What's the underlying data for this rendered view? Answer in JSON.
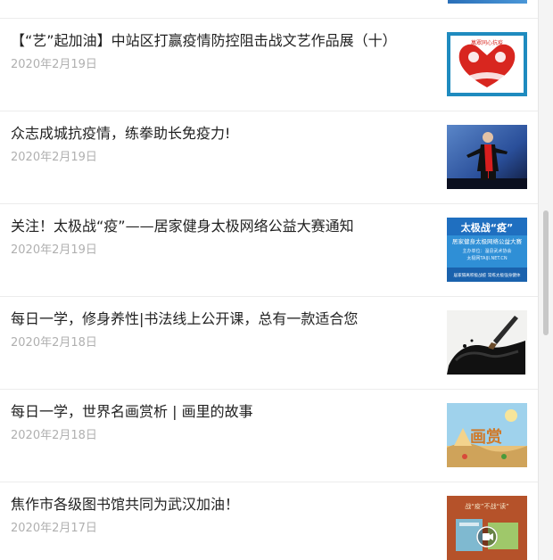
{
  "articles": [
    {
      "title": "【“艺”起加油】中站区打赢疫情防控阻击战文艺作品展（十）",
      "date": "2020年2月19日",
      "thumb_text": "萬眾同心抗疫"
    },
    {
      "title": "众志成城抗疫情，练拳助长免疫力!",
      "date": "2020年2月19日"
    },
    {
      "title": "关注！太极战“疫”——居家健身太极网络公益大赛通知",
      "date": "2020年2月19日",
      "thumb_text": "太极战“疫”",
      "thumb_subtext": "居家健身太极网络公益大赛",
      "thumb_url_text": "主办单位：温县武术协会",
      "thumb_url2_text": "太极网TAIJI.NET.CN",
      "thumb_footer_text": "居家隔离积极战疫 常练太极强身健体"
    },
    {
      "title": "每日一学，修身养性|书法线上公开课，总有一款适合您",
      "date": "2020年2月18日"
    },
    {
      "title": "每日一学，世界名画赏析 | 画里的故事",
      "date": "2020年2月18日",
      "thumb_text": "画赏"
    },
    {
      "title": "焦作市各级图书馆共同为武汉加油！",
      "date": "2020年2月17日",
      "thumb_text": "战“疫”不战“读”"
    }
  ],
  "colors": {
    "title": "#222222",
    "date": "#b0b0b0",
    "divider": "#ececec"
  }
}
